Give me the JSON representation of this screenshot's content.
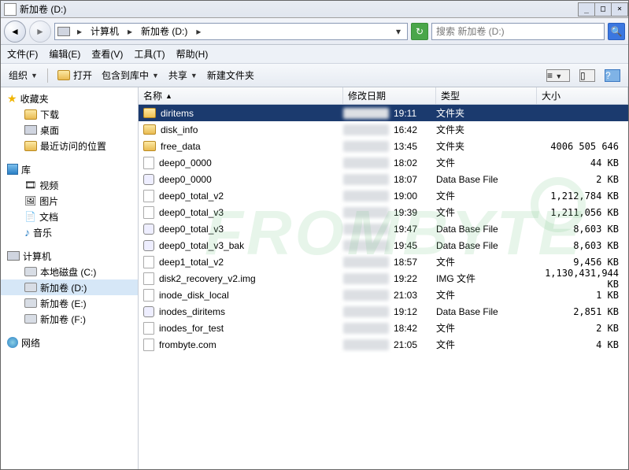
{
  "window": {
    "title": "新加卷 (D:)",
    "buttons": {
      "min": "_",
      "max": "□",
      "close": "×"
    }
  },
  "address": {
    "root": "计算机",
    "segment": "新加卷 (D:)"
  },
  "search": {
    "placeholder": "搜索 新加卷 (D:)"
  },
  "menu": {
    "file": "文件(F)",
    "edit": "编辑(E)",
    "view": "查看(V)",
    "tools": "工具(T)",
    "help": "帮助(H)"
  },
  "toolbar": {
    "organize": "组织",
    "open": "打开",
    "include": "包含到库中",
    "share": "共享",
    "newfolder": "新建文件夹"
  },
  "tree": {
    "favorites": "收藏夹",
    "downloads": "下载",
    "desktop": "桌面",
    "recent": "最近访问的位置",
    "libraries": "库",
    "videos": "视频",
    "pictures": "图片",
    "documents": "文档",
    "music": "音乐",
    "computer": "计算机",
    "local_c": "本地磁盘 (C:)",
    "vol_d": "新加卷 (D:)",
    "vol_e": "新加卷 (E:)",
    "vol_f": "新加卷 (F:)",
    "network": "网络"
  },
  "columns": {
    "name": "名称",
    "date": "修改日期",
    "type": "类型",
    "size": "大小"
  },
  "rows": [
    {
      "name": "diritems",
      "icon": "folder",
      "time": "19:11",
      "type": "文件夹",
      "size": "",
      "selected": true
    },
    {
      "name": "disk_info",
      "icon": "folder",
      "time": "16:42",
      "type": "文件夹",
      "size": ""
    },
    {
      "name": "free_data",
      "icon": "folder",
      "time": "13:45",
      "type": "文件夹",
      "size": "4006 505 646"
    },
    {
      "name": "deep0_0000",
      "icon": "file",
      "time": "18:02",
      "type": "文件",
      "size": "44 KB"
    },
    {
      "name": "deep0_0000",
      "icon": "db",
      "time": "18:07",
      "type": "Data Base File",
      "size": "2 KB"
    },
    {
      "name": "deep0_total_v2",
      "icon": "file",
      "time": "19:00",
      "type": "文件",
      "size": "1,212,784 KB"
    },
    {
      "name": "deep0_total_v3",
      "icon": "file",
      "time": "19:39",
      "type": "文件",
      "size": "1,211,056 KB"
    },
    {
      "name": "deep0_total_v3",
      "icon": "db",
      "time": "19:47",
      "type": "Data Base File",
      "size": "8,603 KB"
    },
    {
      "name": "deep0_total_v3_bak",
      "icon": "db",
      "time": "19:45",
      "type": "Data Base File",
      "size": "8,603 KB"
    },
    {
      "name": "deep1_total_v2",
      "icon": "file",
      "time": "18:57",
      "type": "文件",
      "size": "9,456 KB"
    },
    {
      "name": "disk2_recovery_v2.img",
      "icon": "file",
      "time": "19:22",
      "type": "IMG 文件",
      "size": "1,130,431,944 KB"
    },
    {
      "name": "inode_disk_local",
      "icon": "file",
      "time": "21:03",
      "type": "文件",
      "size": "1 KB"
    },
    {
      "name": "inodes_diritems",
      "icon": "db",
      "time": "19:12",
      "type": "Data Base File",
      "size": "2,851 KB"
    },
    {
      "name": "inodes_for_test",
      "icon": "file",
      "time": "18:42",
      "type": "文件",
      "size": "2 KB"
    },
    {
      "name": "frombyte.com",
      "icon": "file",
      "time": "21:05",
      "type": "文件",
      "size": "4 KB"
    }
  ],
  "watermark": "FROMBYTE"
}
